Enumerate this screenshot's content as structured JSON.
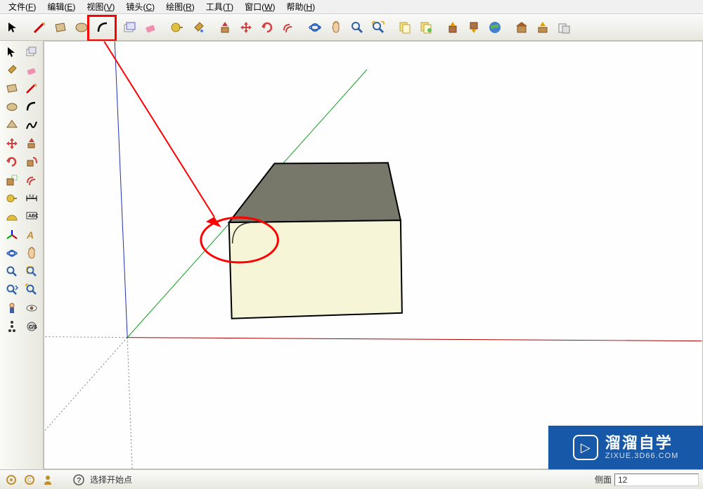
{
  "menu": {
    "file": {
      "label": "文件",
      "mn": "F"
    },
    "edit": {
      "label": "编辑",
      "mn": "E"
    },
    "view": {
      "label": "视图",
      "mn": "V"
    },
    "camera": {
      "label": "镜头",
      "mn": "C"
    },
    "draw": {
      "label": "绘图",
      "mn": "R"
    },
    "tools": {
      "label": "工具",
      "mn": "T"
    },
    "window": {
      "label": "窗口",
      "mn": "W"
    },
    "help": {
      "label": "帮助",
      "mn": "H"
    }
  },
  "status": {
    "hint": "选择开始点",
    "measure_label": "侧面",
    "measure_value": "12"
  },
  "watermark": {
    "main": "溜溜自学",
    "sub": "ZIXUE.3D66.COM"
  }
}
